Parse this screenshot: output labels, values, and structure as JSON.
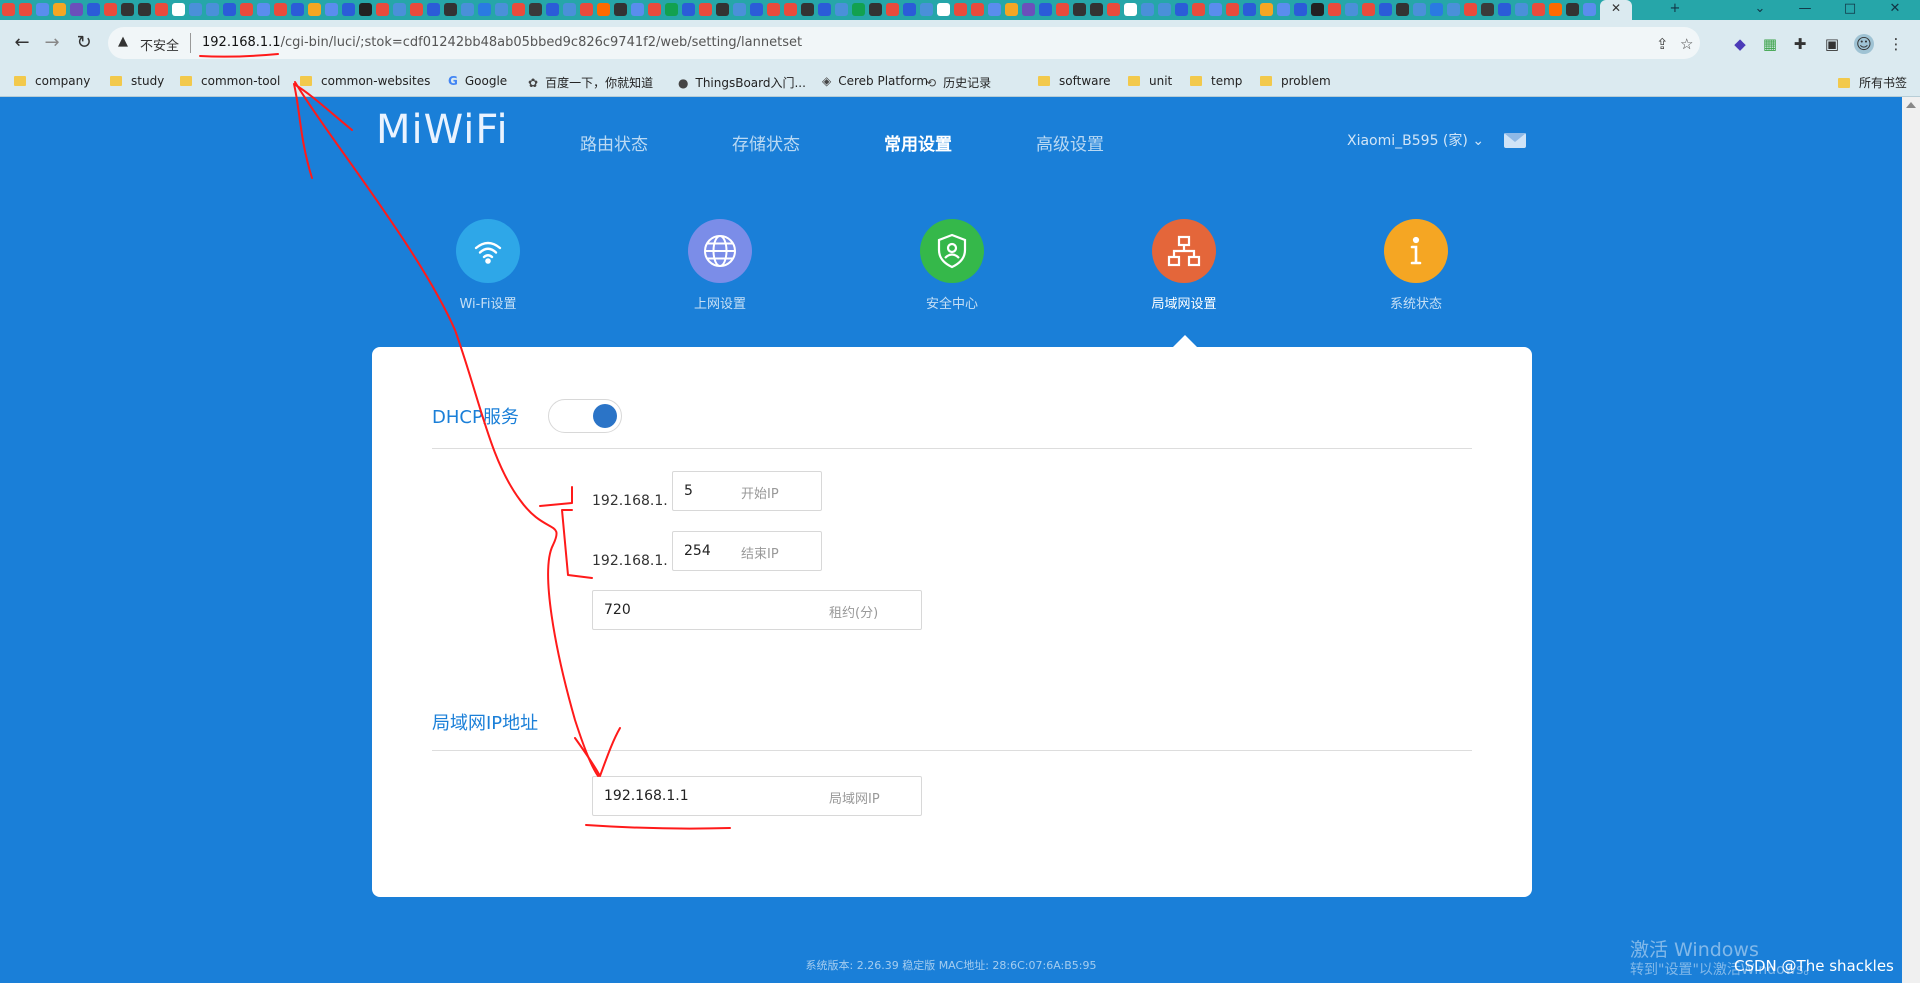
{
  "browser": {
    "window_controls": {
      "minimize": "—",
      "maximize": "□",
      "close": "✕"
    },
    "new_tab": "+",
    "tab_icon_colors": [
      "#e94b3c",
      "#e94b3c",
      "#5a8dee",
      "#f5a623",
      "#6b4fbb",
      "#2b5cd8",
      "#e94b3c",
      "#333333",
      "#333333",
      "#e94b3c",
      "#ffffff",
      "#4a90d9",
      "#4a90d9",
      "#2b5cd8",
      "#e94b3c",
      "#5a8dee",
      "#e94b3c",
      "#2b5cd8",
      "#f5a623",
      "#5a8dee",
      "#2b5cd8",
      "#222222",
      "#e94b3c",
      "#4a90d9",
      "#e94b3c",
      "#2b5cd8",
      "#333333",
      "#4a90d9",
      "#2a7ae2",
      "#4a90d9",
      "#e94b3c",
      "#3a3a3a",
      "#2b5cd8",
      "#4a90d9",
      "#e94b3c",
      "#ff6a00",
      "#333333",
      "#5a8dee",
      "#e94b3c",
      "#12a150",
      "#2b5cd8",
      "#e94b3c",
      "#333333",
      "#4a90d9",
      "#2b5cd8",
      "#e94b3c",
      "#e94b3c",
      "#333333",
      "#2b5cd8",
      "#4a90d9",
      "#12a150",
      "#333333",
      "#e94b3c",
      "#2b5cd8",
      "#4a90d9",
      "#ffffff"
    ],
    "security_label": "不安全",
    "url_host": "192.168.1.1",
    "url_path": "/cgi-bin/luci/;stok=cdf01242bb48ab05bbed9c826c9741f2/web/setting/lannetset",
    "bookmarks": [
      {
        "label": "company",
        "type": "folder"
      },
      {
        "label": "study",
        "type": "folder"
      },
      {
        "label": "common-tool",
        "type": "folder"
      },
      {
        "label": "common-websites",
        "type": "folder"
      },
      {
        "label": "Google",
        "type": "google"
      },
      {
        "label": "百度一下，你就知道",
        "type": "baidu"
      },
      {
        "label": "ThingsBoard入门...",
        "type": "github"
      },
      {
        "label": "Cereb Platform",
        "type": "cereb"
      },
      {
        "label": "历史记录",
        "type": "history"
      },
      {
        "label": "software",
        "type": "folder"
      },
      {
        "label": "unit",
        "type": "folder"
      },
      {
        "label": "temp",
        "type": "folder"
      },
      {
        "label": "problem",
        "type": "folder"
      }
    ],
    "all_bookmarks": "所有书签"
  },
  "router": {
    "logo": "MiWiFi",
    "nav": [
      {
        "label": "路由状态",
        "active": false
      },
      {
        "label": "存储状态",
        "active": false
      },
      {
        "label": "常用设置",
        "active": true
      },
      {
        "label": "高级设置",
        "active": false
      }
    ],
    "device_name": "Xiaomi_B595 (家)",
    "categories": [
      {
        "label": "Wi-Fi设置",
        "color": "#2ea7e8",
        "icon": "wifi-icon"
      },
      {
        "label": "上网设置",
        "color": "#7b8de8",
        "icon": "globe-icon"
      },
      {
        "label": "安全中心",
        "color": "#35b84a",
        "icon": "shield-icon"
      },
      {
        "label": "局域网设置",
        "color": "#e4663a",
        "icon": "network-icon",
        "active": true
      },
      {
        "label": "系统状态",
        "color": "#f5a623",
        "icon": "info-icon"
      }
    ],
    "dhcp": {
      "title": "DHCP服务",
      "enabled": true,
      "ip_prefix": "192.168.1.",
      "start_ip": "5",
      "start_ip_placeholder": "开始IP",
      "end_ip": "254",
      "end_ip_placeholder": "结束IP",
      "lease": "720",
      "lease_placeholder": "租约(分)"
    },
    "lan": {
      "title": "局域网IP地址",
      "ip": "192.168.1.1",
      "ip_placeholder": "局域网IP"
    },
    "footer": "系统版本: 2.26.39 稳定版   MAC地址: 28:6C:07:6A:B5:95"
  },
  "overlay": {
    "windows_activate_title": "激活 Windows",
    "windows_activate_sub": "转到\"设置\"以激活Windows。",
    "csdn_watermark": "CSDN @The shackles"
  }
}
